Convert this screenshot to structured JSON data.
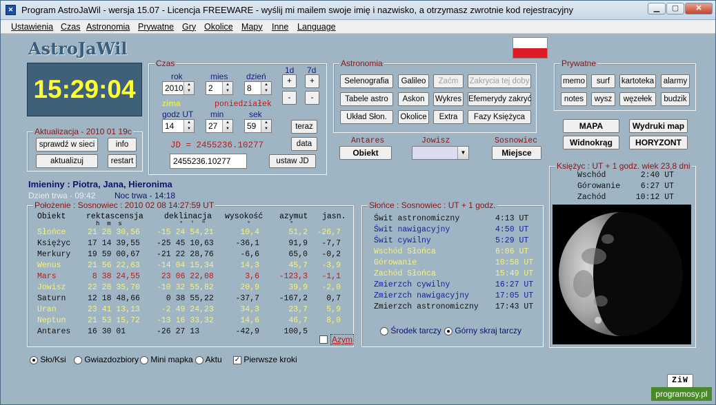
{
  "window": {
    "title": "Program AstroJaWil - wersja 15.07 - Licencja FREEWARE - wyślij mi mailem swoje imię i nazwisko, a otrzymasz zwrotnie kod rejestracyjny"
  },
  "menu": [
    "Ustawienia",
    "Czas",
    "Astronomia",
    "Prywatne",
    "Gry",
    "Okolice",
    "Mapy",
    "Inne",
    "Language"
  ],
  "app_title": "AstroJaWil",
  "clock": "15:29:04",
  "czas": {
    "label": "Czas",
    "rok_label": "rok",
    "mies_label": "mies",
    "dzien_label": "dzień",
    "rok": "2010",
    "mies": "2",
    "dzien": "8",
    "step1": "1d",
    "step7": "7d",
    "plus": "+",
    "minus": "-",
    "season": "zima",
    "weekday": "poniedziałek",
    "godz_label": "godz UT",
    "min_label": "min",
    "sek_label": "sek",
    "godz": "14",
    "min": "27",
    "sek": "59",
    "teraz": "teraz",
    "jd_text": "JD = 2455236.10277",
    "data_btn": "data",
    "jd_input": "2455236.10277",
    "ustaw_jd": "ustaw JD"
  },
  "aktualizacja": {
    "label": "Aktualizacja - 2010 01 19c",
    "sprawdz": "sprawdź w sieci",
    "info": "info",
    "aktualizuj": "aktualizuj",
    "restart": "restart"
  },
  "astronomia": {
    "label": "Astronomia",
    "buttons": [
      "Selenografia",
      "Galileo",
      "Zaćm",
      "Zakrycia tej doby",
      "Tabele astro",
      "Askon",
      "Wykres",
      "Efemerydy zakryć",
      "Układ Słon.",
      "Okolice",
      "Extra",
      "Fazy Księżyca"
    ]
  },
  "prywatne": {
    "label": "Prywatne",
    "buttons": [
      "memo",
      "surf",
      "kartoteka",
      "alarmy",
      "notes",
      "wysz",
      "węzełek",
      "budzik"
    ]
  },
  "maps": {
    "mapa": "MAPA",
    "wydruki": "Wydruki map",
    "widnokrag": "Widnokrąg",
    "horyzont": "HORYZONT"
  },
  "stars": {
    "antares_label": "Antares",
    "antares_btn": "Obiekt",
    "jowisz_label": "Jowisz",
    "sosnowiec_label": "Sosnowiec",
    "miejsce_btn": "Miejsce"
  },
  "imieniny": "Imieniny : Piotra, Jana, Hieronima",
  "dzien": "Dzień trwa - 09:42",
  "noc": "Noc trwa - 14:18",
  "planets": {
    "label": "Położenie : Sosnowiec : 2010 02 08   14:27:59 UT",
    "headers": [
      "Obiekt",
      "rektascensja",
      "deklinacja",
      "wysokość",
      "azymut",
      "jasn."
    ],
    "subheaders": [
      "h  m  s",
      "°  '  \"",
      "°",
      "°"
    ],
    "rows": [
      {
        "name": "Słońce",
        "ra": "21 28 30,56",
        "dec": "-15 24 54,21",
        "alt": "10,4",
        "az": "51,2",
        "mag": "-26,7",
        "color": "#f6f27a"
      },
      {
        "name": "Księżyc",
        "ra": "17 14 39,55",
        "dec": "-25 45 10,63",
        "alt": "-36,1",
        "az": "91,9",
        "mag": "-7,7",
        "color": "#111111"
      },
      {
        "name": "Merkury",
        "ra": "19 59 00,67",
        "dec": "-21 22 28,76",
        "alt": "-6,6",
        "az": "65,0",
        "mag": "-0,2",
        "color": "#111111"
      },
      {
        "name": "Wenus",
        "ra": "21 56 22,63",
        "dec": "-14 04 15,34",
        "alt": "14,3",
        "az": "45,7",
        "mag": "-3,9",
        "color": "#f6f27a"
      },
      {
        "name": "Mars",
        "ra": " 8 38 24,55",
        "dec": " 23 06 22,08",
        "alt": "3,6",
        "az": "-123,3",
        "mag": "-1,1",
        "color": "#c01818"
      },
      {
        "name": "Jowisz",
        "ra": "22 28 35,70",
        "dec": "-10 32 55,82",
        "alt": "20,9",
        "az": "39,9",
        "mag": "-2,0",
        "color": "#f6f27a"
      },
      {
        "name": "Saturn",
        "ra": "12 18 48,66",
        "dec": "  0 38 55,22",
        "alt": "-37,7",
        "az": "-167,2",
        "mag": "0,7",
        "color": "#111111"
      },
      {
        "name": "Uran",
        "ra": "23 41 13,13",
        "dec": " -2 49 24,23",
        "alt": "34,3",
        "az": "23,7",
        "mag": "5,9",
        "color": "#f6f27a"
      },
      {
        "name": "Neptun",
        "ra": "21 53 15,72",
        "dec": "-13 16 33,32",
        "alt": "14,6",
        "az": "46,7",
        "mag": "8,0",
        "color": "#f6f27a"
      },
      {
        "name": "Antares",
        "ra": "16 30 01",
        "dec": "-26 27 13",
        "alt": "-42,9",
        "az": "100,5",
        "mag": "",
        "color": "#111111"
      }
    ],
    "azym": "Azym"
  },
  "sun": {
    "label": "Słońce : Sosnowiec : UT + 1 godz.",
    "rows": [
      {
        "name": "Świt astronomiczny",
        "time": "4:13 UT",
        "color": "#111111"
      },
      {
        "name": "Świt nawigacyjny",
        "time": "4:50 UT",
        "color": "#1a1aa0"
      },
      {
        "name": "Świt cywilny",
        "time": "5:29 UT",
        "color": "#1a1aa0"
      },
      {
        "name": "Wschód Słońca",
        "time": "6:06 UT",
        "color": "#f6f27a"
      },
      {
        "name": "Górowanie",
        "time": "10:58 UT",
        "color": "#f6f27a"
      },
      {
        "name": "Zachód Słońca",
        "time": "15:49 UT",
        "color": "#f6f27a"
      },
      {
        "name": "Zmierzch cywilny",
        "time": "16:27 UT",
        "color": "#1a1aa0"
      },
      {
        "name": "Zmierzch nawigacyjny",
        "time": "17:05 UT",
        "color": "#1a1aa0"
      },
      {
        "name": "Zmierzch astronomiczny",
        "time": "17:43 UT",
        "color": "#111111"
      }
    ],
    "radio1": "Środek tarczy",
    "radio2": "Górny skraj tarczy"
  },
  "moon": {
    "label": "Księżyc : UT + 1 godz.   wiek 23,8 dni",
    "rows": [
      {
        "name": "Wschód",
        "time": "2:40 UT"
      },
      {
        "name": "Górowanie",
        "time": "6:27 UT"
      },
      {
        "name": "Zachód",
        "time": "10:12 UT"
      }
    ]
  },
  "bottom": {
    "r1": "Sło/Ksi",
    "r2": "Gwiazdozbiory",
    "r3": "Mini mapka",
    "r4": "Aktu",
    "chk": "Pierwsze kroki",
    "ziw": "ZiW"
  },
  "watermark": "programosy.pl",
  "colors": {
    "bg": "#9fb5c4",
    "clock_bg": "#3e6179",
    "clock_fg": "#ffff33",
    "label_red": "#8b1414"
  }
}
